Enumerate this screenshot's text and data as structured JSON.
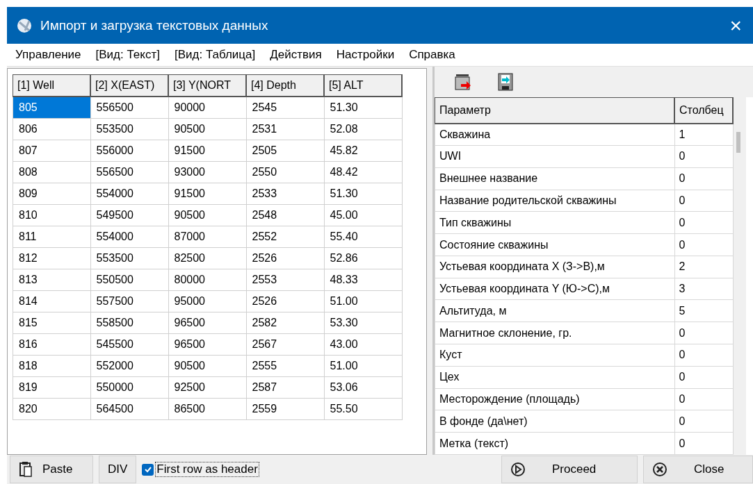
{
  "window": {
    "title": "Импорт и загрузка текстовых данных",
    "close": "×"
  },
  "menu": [
    "Управление",
    "[Вид: Текст]",
    "[Вид: Таблица]",
    "Действия",
    "Настройки",
    "Справка"
  ],
  "data_table": {
    "columns": [
      "[1] Well",
      "[2] X(EAST)",
      "[3] Y(NORT",
      "[4] Depth",
      "[5] ALT"
    ],
    "rows": [
      {
        "selected": true,
        "cells": [
          "805",
          "556500",
          "90000",
          "2545",
          "51.30"
        ]
      },
      {
        "selected": false,
        "cells": [
          "806",
          "553500",
          "90500",
          "2531",
          "52.08"
        ]
      },
      {
        "selected": false,
        "cells": [
          "807",
          "556000",
          "91500",
          "2505",
          "45.82"
        ]
      },
      {
        "selected": false,
        "cells": [
          "808",
          "556500",
          "93000",
          "2550",
          "48.42"
        ]
      },
      {
        "selected": false,
        "cells": [
          "809",
          "554000",
          "91500",
          "2533",
          "51.30"
        ]
      },
      {
        "selected": false,
        "cells": [
          "810",
          "549500",
          "90500",
          "2548",
          "45.00"
        ]
      },
      {
        "selected": false,
        "cells": [
          "811",
          "554000",
          "87000",
          "2552",
          "55.40"
        ]
      },
      {
        "selected": false,
        "cells": [
          "812",
          "553500",
          "82500",
          "2526",
          "52.86"
        ]
      },
      {
        "selected": false,
        "cells": [
          "813",
          "550500",
          "80000",
          "2553",
          "48.33"
        ]
      },
      {
        "selected": false,
        "cells": [
          "814",
          "557500",
          "95000",
          "2526",
          "51.00"
        ]
      },
      {
        "selected": false,
        "cells": [
          "815",
          "558500",
          "96500",
          "2582",
          "53.30"
        ]
      },
      {
        "selected": false,
        "cells": [
          "816",
          "545500",
          "96500",
          "2567",
          "43.00"
        ]
      },
      {
        "selected": false,
        "cells": [
          "818",
          "552000",
          "90500",
          "2555",
          "51.00"
        ]
      },
      {
        "selected": false,
        "cells": [
          "819",
          "550000",
          "92500",
          "2587",
          "53.06"
        ]
      },
      {
        "selected": false,
        "cells": [
          "820",
          "564500",
          "86500",
          "2559",
          "55.50"
        ]
      }
    ]
  },
  "mapping_table": {
    "columns": [
      "Параметр",
      "Столбец"
    ],
    "rows": [
      [
        "Скважина",
        "1"
      ],
      [
        "UWI",
        "0"
      ],
      [
        "Внешнее название",
        "0"
      ],
      [
        "Название родительской скважины",
        "0"
      ],
      [
        "Тип скважины",
        "0"
      ],
      [
        "Состояние скважины",
        "0"
      ],
      [
        "Устьевая координата X (З->В),м",
        "2"
      ],
      [
        "Устьевая координата Y (Ю->С),м",
        "3"
      ],
      [
        "Альтитуда, м",
        "5"
      ],
      [
        "Магнитное склонение, гр.",
        "0"
      ],
      [
        "Куст",
        "0"
      ],
      [
        "Цех",
        "0"
      ],
      [
        "Месторождение (площадь)",
        "0"
      ],
      [
        "В фонде (да\\нет)",
        "0"
      ],
      [
        "Метка (текст)",
        "0"
      ]
    ]
  },
  "bottom_bar": {
    "paste": "Paste",
    "div": "DIV",
    "first_row_header": {
      "label": "First row as header",
      "checked": true
    },
    "proceed": "Proceed",
    "close": "Close"
  }
}
